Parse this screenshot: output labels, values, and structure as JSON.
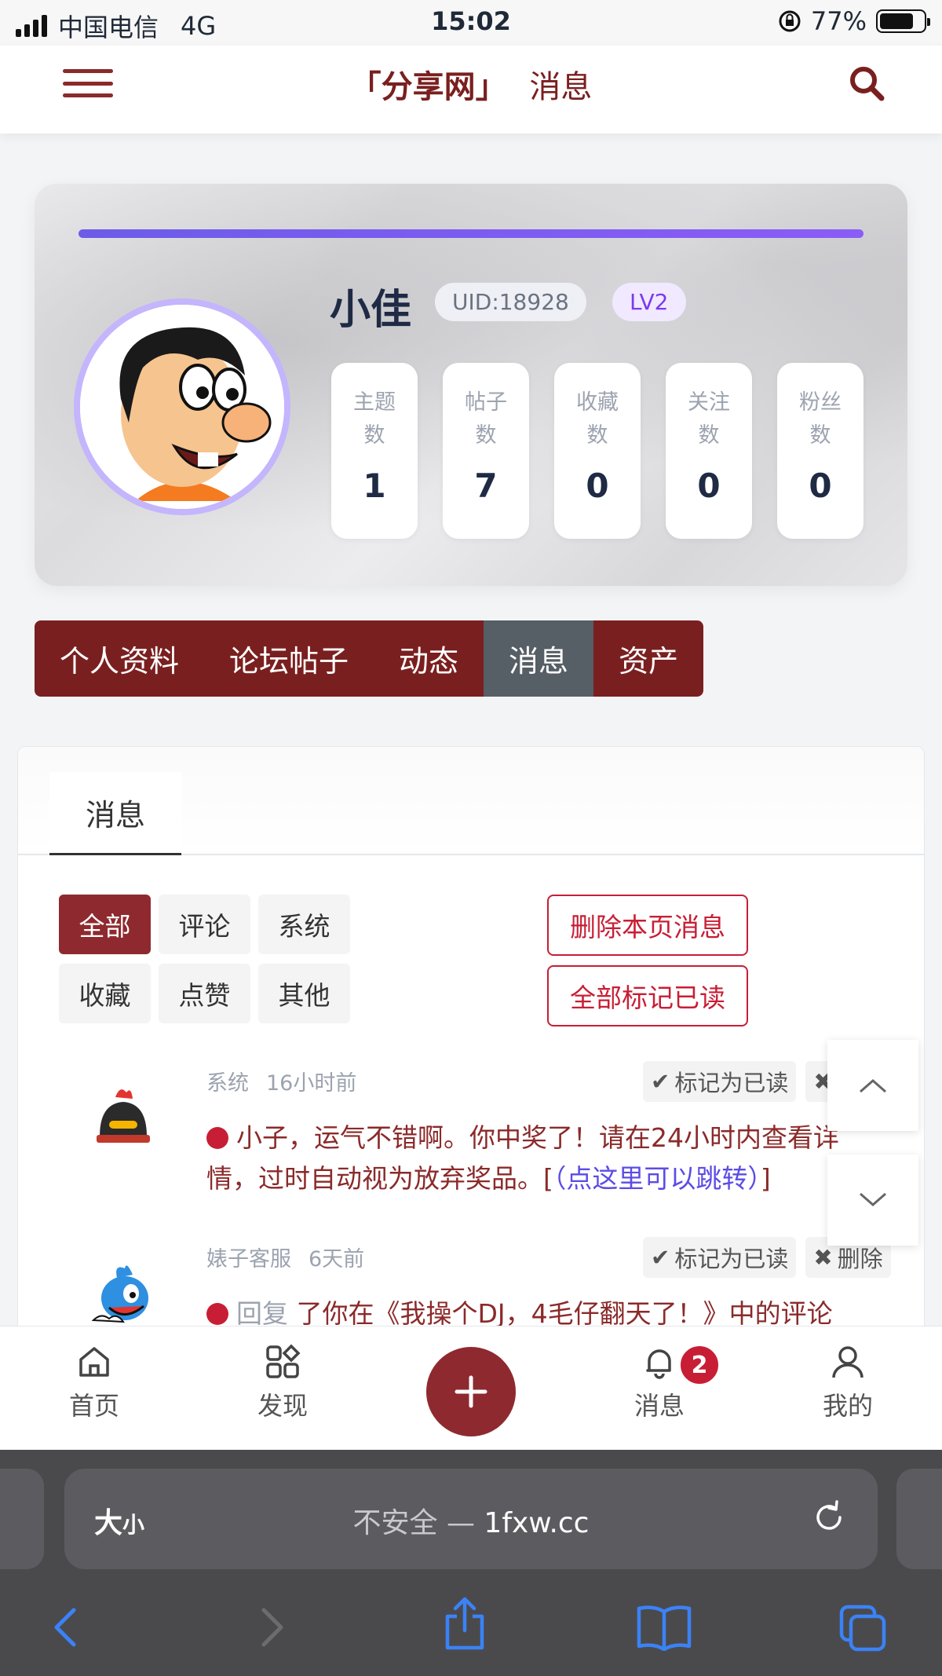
{
  "status_bar": {
    "carrier": "中国电信",
    "network": "4G",
    "time": "15:02",
    "battery": "77%",
    "battery_level": 0.77
  },
  "header": {
    "title_brand": "「分享网」",
    "title_page": "消息",
    "menu_icon": "menu-icon",
    "search_icon": "search-icon"
  },
  "profile": {
    "level_progress": 1.0,
    "name": "小佳",
    "uid": "UID:18928",
    "level": "LV2",
    "stats": [
      {
        "label": "主题数",
        "value": "1"
      },
      {
        "label": "帖子数",
        "value": "7"
      },
      {
        "label": "收藏数",
        "value": "0"
      },
      {
        "label": "关注数",
        "value": "0"
      },
      {
        "label": "粉丝数",
        "value": "0"
      }
    ]
  },
  "nav_tabs": [
    "个人资料",
    "论坛帖子",
    "动态",
    "消息",
    "资产"
  ],
  "nav_active": "消息",
  "messages": {
    "tab": "消息",
    "filters": [
      "全部",
      "评论",
      "系统",
      "收藏",
      "点赞",
      "其他"
    ],
    "filter_active": "全部",
    "delete_page": "删除本页消息",
    "mark_all_read": "全部标记已读",
    "items": [
      {
        "sender": "系统",
        "time": "16小时前",
        "mark_read": "标记为已读",
        "delete": "删除",
        "text": "小子，运气不错啊。你中奖了！请在24小时内查看详情，过时自动视为放弃奖品。[",
        "link": "（点这里可以跳转）",
        "suffix": "]"
      },
      {
        "sender": "婊子客服",
        "time": "6天前",
        "mark_read": "标记为已读",
        "delete": "删除",
        "prefix": "回复",
        "text": "了你在《我操个DJ，4毛仔翻天了！》中的评论"
      }
    ]
  },
  "bottom_nav": {
    "home": "首页",
    "discover": "发现",
    "messages": "消息",
    "messages_badge": "2",
    "mine": "我的"
  },
  "safari": {
    "text_size": "大",
    "text_size_small": "小",
    "insecure": "不安全 —",
    "domain": "1fxw.cc"
  },
  "colors": {
    "brand": "#7a1f1f",
    "accent_red": "#c81e35",
    "purple": "#7c3aed"
  }
}
